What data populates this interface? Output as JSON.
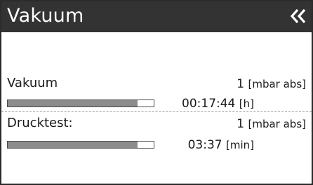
{
  "header": {
    "title": "Vakuum",
    "back_glyph": "«",
    "back_icon": "double-chevron-left-icon"
  },
  "vacuum": {
    "label": "Vakuum",
    "value": "1",
    "unit": "[mbar abs]",
    "progress_fraction": 0.89,
    "time": "00:17:44",
    "time_unit": "[h]"
  },
  "pressure_test": {
    "label": "Drucktest:",
    "value": "1",
    "unit": "[mbar abs]",
    "progress_fraction": 0.89,
    "time": "03:37",
    "time_unit": "[min]"
  },
  "colors": {
    "title_bar": "#333333",
    "bar_fill": "#8c8c8c"
  }
}
